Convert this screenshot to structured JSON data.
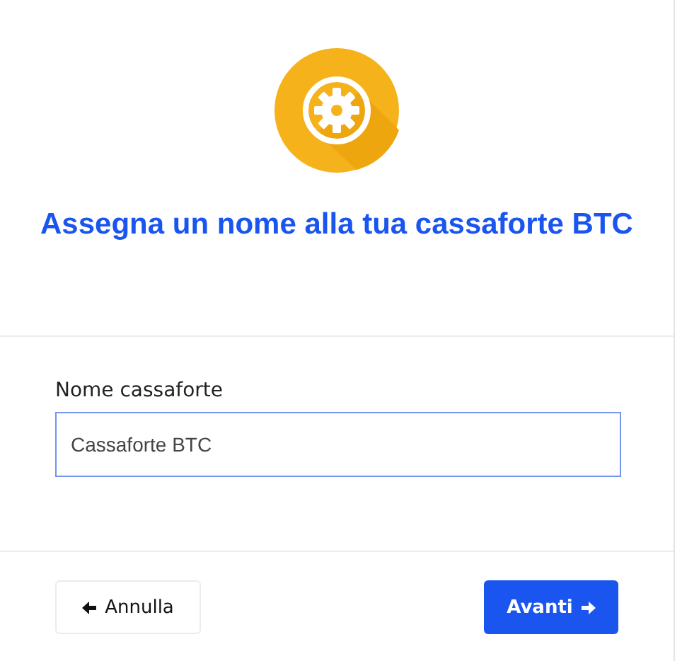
{
  "title": "Assegna un nome alla tua cassaforte BTC",
  "field": {
    "label": "Nome cassaforte",
    "value": "Cassaforte BTC"
  },
  "buttons": [
    {
      "label": "Annulla",
      "kind": "back"
    },
    {
      "label": "Avanti",
      "kind": "next"
    }
  ]
}
